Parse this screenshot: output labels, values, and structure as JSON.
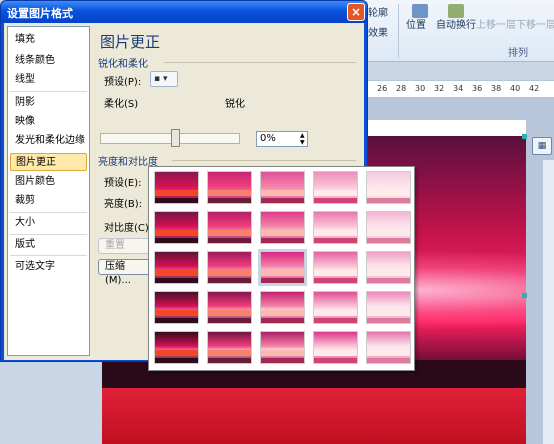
{
  "dialog": {
    "title": "设置图片格式",
    "close_label": "×",
    "heading": "图片更正",
    "nav_items": [
      "填充",
      "线条颜色",
      "线型",
      "阴影",
      "映像",
      "发光和柔化边缘",
      "图片更正",
      "图片颜色",
      "裁剪",
      "大小",
      "版式",
      "可选文字"
    ],
    "selected_index": 6,
    "sharpen_soften": {
      "section": "锐化和柔化",
      "preset_label": "预设(P):",
      "soften_label": "柔化(S)",
      "sharpen_label": "锐化",
      "value": "0%"
    },
    "brightness_contrast": {
      "section": "亮度和对比度",
      "preset_label": "预设(E):",
      "brightness_label": "亮度(B):",
      "contrast_label": "对比度(C):",
      "reset_button": "重置",
      "compress_button": "压缩(M)..."
    }
  },
  "ribbon": {
    "top_partial_1": "轮廓",
    "top_partial_2": "效果",
    "position_label": "位置",
    "wrap_label": "自动换行",
    "bring_forward": "上移一层",
    "send_backward": "下移一层",
    "group_label": "排列"
  },
  "ruler": {
    "ticks": [
      "26",
      "28",
      "30",
      "32",
      "34",
      "36",
      "38",
      "40",
      "42"
    ]
  },
  "layout_options_icon": "layout-options-icon",
  "gallery": {
    "rows": 5,
    "cols": 5,
    "highlighted_row": 2,
    "highlighted_col": 2
  }
}
